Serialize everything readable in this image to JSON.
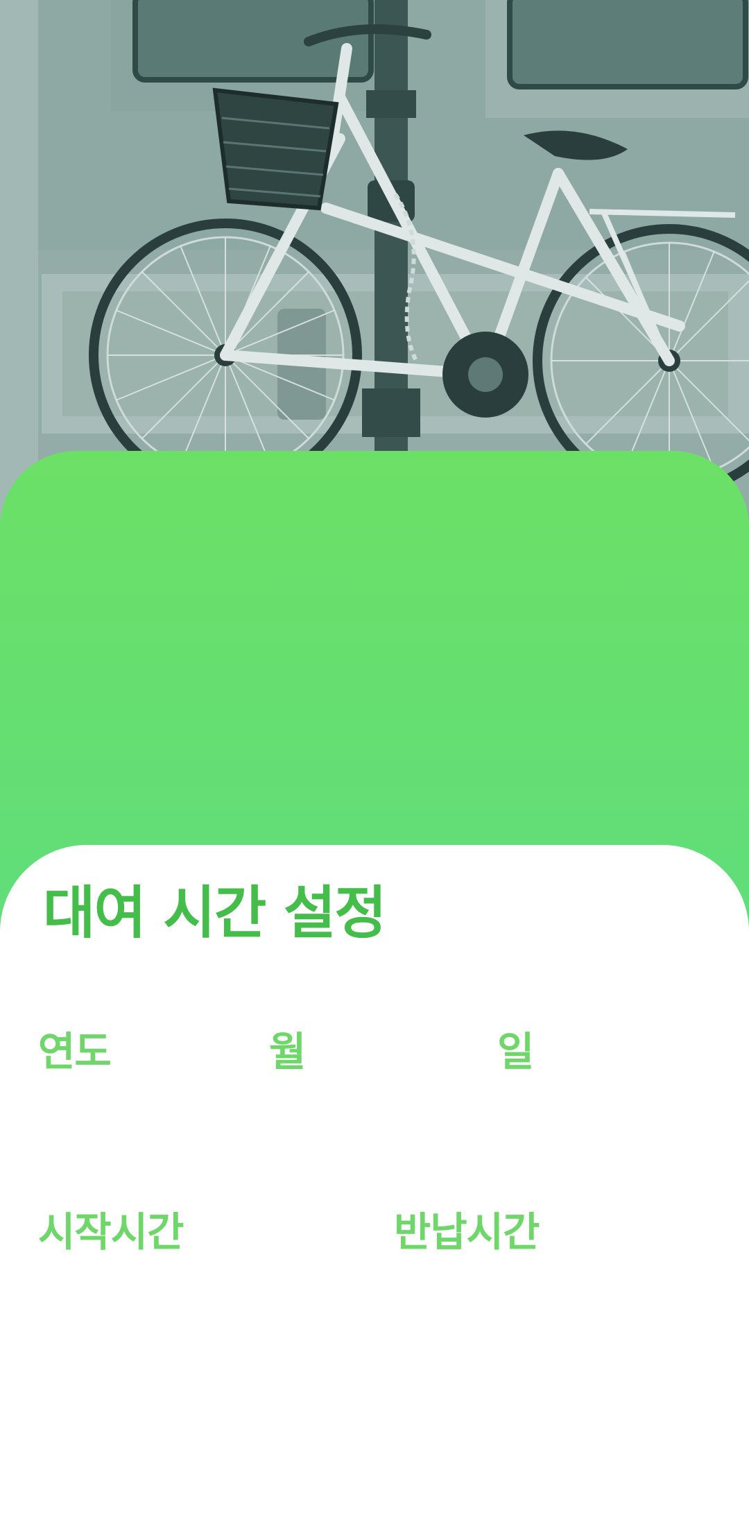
{
  "hero": {
    "image_subject": "bicycle-locked-to-lamp-post",
    "tint": "#7f9a97"
  },
  "colors": {
    "card_green_top": "#6ce066",
    "card_green_bottom": "#5edb84",
    "title_green": "#45bd4b",
    "label_green": "#6fd76a"
  },
  "sheet": {
    "title": "대여 시간 설정"
  },
  "fields": {
    "year_label": "연도",
    "month_label": "월",
    "day_label": "일",
    "start_time_label": "시작시간",
    "return_time_label": "반납시간"
  }
}
